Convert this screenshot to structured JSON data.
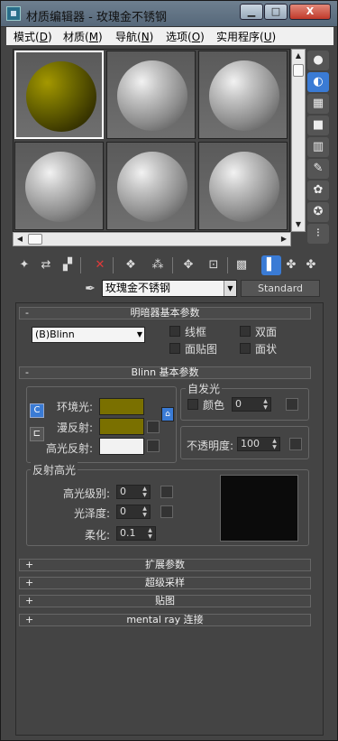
{
  "window": {
    "title": "材质编辑器 - 玫瑰金不锈钢",
    "min_label": "▁",
    "max_label": "□",
    "close_label": "X"
  },
  "menu": {
    "items": [
      {
        "label": "模式(",
        "key": "D",
        "suffix": ")"
      },
      {
        "label": "材质(",
        "key": "M",
        "suffix": ")"
      },
      {
        "label": "导航(",
        "key": "N",
        "suffix": ")"
      },
      {
        "label": "选项(",
        "key": "O",
        "suffix": ")"
      },
      {
        "label": "实用程序(",
        "key": "U",
        "suffix": ")"
      }
    ]
  },
  "material": {
    "name": "玫瑰金不锈钢",
    "type_button": "Standard"
  },
  "shader_rollout": {
    "title": "明暗器基本参数",
    "sign": "-",
    "shader": "(B)Blinn",
    "options": [
      "线框",
      "双面",
      "面贴图",
      "面状"
    ]
  },
  "blinn_rollout": {
    "title": "Blinn 基本参数",
    "sign": "-",
    "ambient_label": "环境光:",
    "diffuse_label": "漫反射:",
    "specular_label": "高光反射:",
    "ambient_color": "#7a7000",
    "diffuse_color": "#7a7000",
    "specular_color": "#f2f2f2",
    "self_illum_group": "自发光",
    "color_checkbox_label": "颜色",
    "self_illum_value": "0",
    "opacity_label": "不透明度:",
    "opacity_value": "100",
    "spec_group": "反射高光",
    "spec_level_label": "高光级别:",
    "spec_level_value": "0",
    "glossiness_label": "光泽度:",
    "glossiness_value": "0",
    "soften_label": "柔化:",
    "soften_value": "0.1"
  },
  "bottom_rollouts": [
    {
      "sign": "+",
      "title": "扩展参数"
    },
    {
      "sign": "+",
      "title": "超级采样"
    },
    {
      "sign": "+",
      "title": "贴图"
    },
    {
      "sign": "+",
      "title": "mental ray 连接"
    }
  ],
  "icons": {
    "side_tools": [
      "sphere-icon",
      "backlight-icon",
      "checker-icon",
      "bg-icon",
      "color-check-icon",
      "make-preview-icon",
      "options-icon",
      "select-by-material-icon",
      "material-navigator-icon"
    ],
    "toolbar": [
      "get-material-icon",
      "put-to-scene-icon",
      "assign-icon",
      "reset-icon",
      "copy-icon",
      "unique-icon",
      "put-to-library-icon",
      "effects-channel-icon",
      "show-in-viewport-icon",
      "show-end-result-icon",
      "go-to-parent-icon",
      "go-forward-icon"
    ]
  }
}
